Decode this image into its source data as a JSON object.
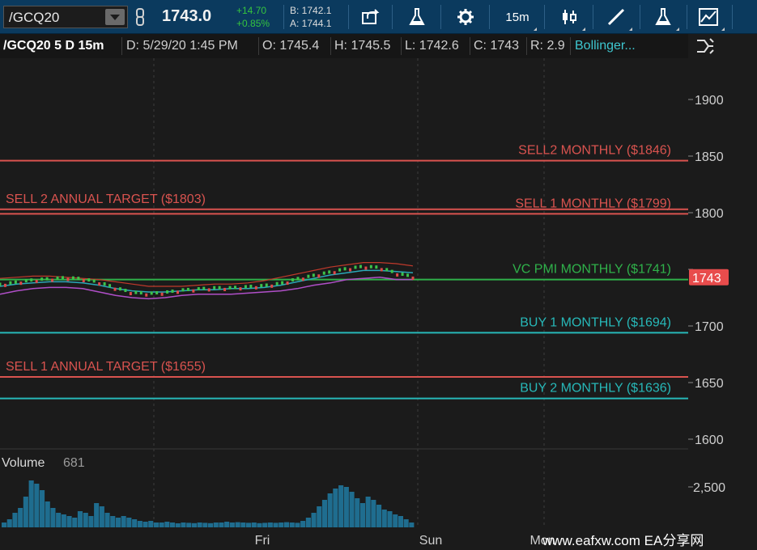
{
  "toolbar": {
    "symbol": "/GCQ20",
    "last_price": "1743.0",
    "change": "+14.70",
    "change_pct": "+0.85%",
    "bid": "B: 1742.1",
    "ask": "A: 1744.1",
    "timeframe": "15m",
    "icons": [
      "dropdown-icon",
      "link-icon",
      "share-icon",
      "flask-icon",
      "gear-icon",
      "candlestick-icon",
      "drawing-line-icon",
      "study-flask-icon",
      "chart-style-icon"
    ]
  },
  "header": {
    "symbol_period": "/GCQ20 5 D 15m",
    "date": "D: 5/29/20 1:45 PM",
    "open": "O: 1745.4",
    "high": "H: 1745.5",
    "low": "L: 1742.6",
    "close": "C: 1743",
    "range": "R: 2.9",
    "study": "Bollinger..."
  },
  "volume_panel": {
    "name": "Volume",
    "value": "681"
  },
  "watermark": "www.eafxw.com   EA分享网",
  "colors": {
    "background": "#1b1b1b",
    "toolbar": "#0b3a5e",
    "sell": "#d9534f",
    "vc_pmi": "#2fb14a",
    "buy": "#27b8b8",
    "price_marker": "#e84c4c",
    "volume": "#1f6d8f"
  },
  "chart_data": {
    "type": "line",
    "y_axis": {
      "ylim": [
        1590,
        1930
      ],
      "ticks": [
        1600,
        1650,
        1700,
        1750,
        1800,
        1850,
        1900
      ],
      "tick_labels": [
        "1600",
        "1650",
        "1700",
        "",
        "1800",
        "1850",
        "1900"
      ]
    },
    "x_axis": {
      "tick_labels": [
        "Fri",
        "Sun",
        "Mon"
      ]
    },
    "current_price": {
      "value": 1743,
      "label": "1743"
    },
    "levels": [
      {
        "label": "SELL2  MONTHLY  ($1846)",
        "value": 1846,
        "color": "#d9534f",
        "side": "right"
      },
      {
        "label": "SELL 1  MONTHLY  ($1799)",
        "value": 1799,
        "color": "#d9534f",
        "side": "right"
      },
      {
        "label": "SELL 2 ANNUAL TARGET ($1803)",
        "value": 1803,
        "color": "#d9534f",
        "side": "left"
      },
      {
        "label": "VC PMI  MONTHLY  ($1741)",
        "value": 1741,
        "color": "#2fb14a",
        "side": "right"
      },
      {
        "label": "BUY 1  MONTHLY  ($1694)",
        "value": 1694,
        "color": "#27b8b8",
        "side": "right"
      },
      {
        "label": "SELL 1 ANNUAL TARGET ($1655)",
        "value": 1655,
        "color": "#d9534f",
        "side": "left"
      },
      {
        "label": "BUY 2  MONTHLY  ($1636)",
        "value": 1636,
        "color": "#27b8b8",
        "side": "right"
      }
    ],
    "price_series": [
      1736,
      1738,
      1740,
      1741,
      1742,
      1741,
      1738,
      1733,
      1729,
      1728,
      1729,
      1731,
      1732,
      1733,
      1733,
      1734,
      1735,
      1737,
      1741,
      1744,
      1747,
      1750,
      1752,
      1751,
      1746,
      1743
    ],
    "bollinger_upper": [
      1742,
      1743,
      1744,
      1744,
      1743,
      1742,
      1741,
      1739,
      1737,
      1735,
      1735,
      1735,
      1736,
      1737,
      1737,
      1738,
      1740,
      1743,
      1746,
      1749,
      1752,
      1754,
      1756,
      1756,
      1755,
      1753
    ],
    "bollinger_middle": [
      1735,
      1737,
      1738,
      1739,
      1739,
      1738,
      1736,
      1733,
      1731,
      1730,
      1730,
      1731,
      1732,
      1732,
      1733,
      1733,
      1734,
      1736,
      1739,
      1742,
      1745,
      1747,
      1749,
      1749,
      1748,
      1747
    ],
    "bollinger_lower": [
      1728,
      1731,
      1733,
      1734,
      1734,
      1733,
      1730,
      1727,
      1725,
      1724,
      1725,
      1727,
      1728,
      1728,
      1728,
      1729,
      1730,
      1731,
      1733,
      1736,
      1738,
      1741,
      1742,
      1743,
      1741,
      1741
    ],
    "volume": {
      "ylabel_tick": "2,500",
      "current": 681,
      "values": [
        300,
        500,
        900,
        1200,
        1900,
        2900,
        2700,
        2300,
        1600,
        1200,
        900,
        800,
        700,
        600,
        1000,
        900,
        700,
        1500,
        1300,
        900,
        700,
        600,
        700,
        600,
        500,
        400,
        350,
        400,
        300,
        300,
        350,
        300,
        250,
        300,
        280,
        260,
        300,
        280,
        260,
        300,
        300,
        350,
        300,
        320,
        300,
        280,
        300,
        260,
        280,
        300,
        280,
        300,
        320,
        300,
        280,
        400,
        600,
        900,
        1300,
        1700,
        2100,
        2400,
        2600,
        2500,
        2200,
        1800,
        1500,
        1900,
        1700,
        1400,
        1100,
        1000,
        800,
        700,
        500,
        300
      ]
    }
  }
}
